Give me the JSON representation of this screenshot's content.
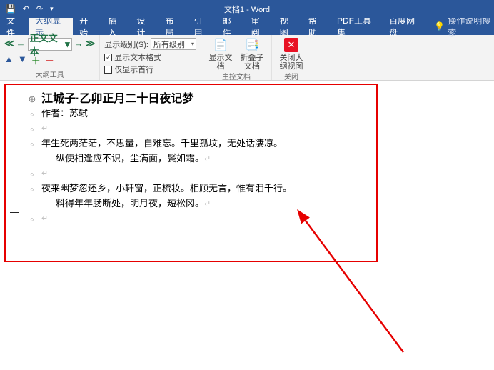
{
  "title": "文档1 - Word",
  "qat": {
    "save": "保存",
    "undo": "撤销",
    "redo": "重做",
    "custom": "自定义"
  },
  "tabs": {
    "file": "文件",
    "outline": "大纲显示",
    "home": "开始",
    "insert": "插入",
    "design": "设计",
    "layout": "布局",
    "references": "引用",
    "mailings": "邮件",
    "review": "审阅",
    "view": "视图",
    "help": "帮助",
    "pdf": "PDF工具集",
    "baidu": "百度网盘",
    "tell_me": "操作说明搜索"
  },
  "ribbon": {
    "style_value": "正文文本",
    "outline_tools": "大纲工具",
    "show_level_label": "显示级别(S):",
    "show_level_value": "所有级别",
    "show_formatting": "显示文本格式",
    "first_line_only": "仅显示首行",
    "show_doc": "显示文档",
    "collapse_sub": "折叠子文档",
    "master_doc": "主控文档",
    "close_outline": "关闭大纲视图",
    "close_group": "关闭"
  },
  "doc": {
    "h1": "江城子·乙卯正月二十日夜记梦",
    "author": "作者：苏轼",
    "p1a": "年生死两茫茫，不思量，自难忘。千里孤坟，无处话凄凉。",
    "p1b": "纵使相逢应不识，尘满面，鬓如霜。",
    "p2a": "夜来幽梦忽还乡，小轩窗，正梳妆。相顾无言，惟有泪千行。",
    "p2b": "料得年年肠断处，明月夜，短松冈。",
    "ret": "↵"
  }
}
